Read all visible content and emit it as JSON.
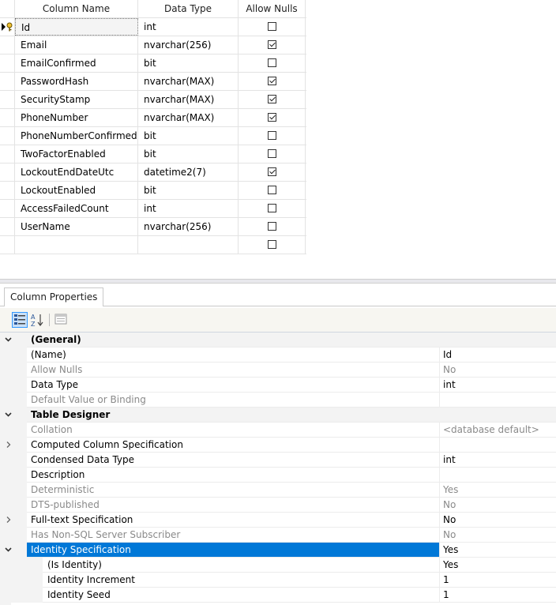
{
  "grid": {
    "headers": {
      "name": "Column Name",
      "type": "Data Type",
      "nulls": "Allow Nulls"
    },
    "rows": [
      {
        "name": "Id",
        "type": "int",
        "allow_nulls": false,
        "primary_key": true
      },
      {
        "name": "Email",
        "type": "nvarchar(256)",
        "allow_nulls": true
      },
      {
        "name": "EmailConfirmed",
        "type": "bit",
        "allow_nulls": false
      },
      {
        "name": "PasswordHash",
        "type": "nvarchar(MAX)",
        "allow_nulls": true
      },
      {
        "name": "SecurityStamp",
        "type": "nvarchar(MAX)",
        "allow_nulls": true
      },
      {
        "name": "PhoneNumber",
        "type": "nvarchar(MAX)",
        "allow_nulls": true
      },
      {
        "name": "PhoneNumberConfirmed",
        "type": "bit",
        "allow_nulls": false
      },
      {
        "name": "TwoFactorEnabled",
        "type": "bit",
        "allow_nulls": false
      },
      {
        "name": "LockoutEndDateUtc",
        "type": "datetime2(7)",
        "allow_nulls": true
      },
      {
        "name": "LockoutEnabled",
        "type": "bit",
        "allow_nulls": false
      },
      {
        "name": "AccessFailedCount",
        "type": "int",
        "allow_nulls": false
      },
      {
        "name": "UserName",
        "type": "nvarchar(256)",
        "allow_nulls": false
      },
      {
        "name": "",
        "type": "",
        "allow_nulls": false
      }
    ]
  },
  "properties": {
    "tab_label": "Column Properties",
    "rows": [
      {
        "label": "(General)",
        "value": "",
        "kind": "category",
        "expander": "collapse"
      },
      {
        "label": "(Name)",
        "value": "Id",
        "kind": "normal"
      },
      {
        "label": "Allow Nulls",
        "value": "No",
        "kind": "dim"
      },
      {
        "label": "Data Type",
        "value": "int",
        "kind": "normal"
      },
      {
        "label": "Default Value or Binding",
        "value": "",
        "kind": "dim"
      },
      {
        "label": "Table Designer",
        "value": "",
        "kind": "category",
        "expander": "collapse"
      },
      {
        "label": "Collation",
        "value": "<database default>",
        "kind": "dim"
      },
      {
        "label": "Computed Column Specification",
        "value": "",
        "kind": "normal",
        "expander": "expand"
      },
      {
        "label": "Condensed Data Type",
        "value": "int",
        "kind": "normal"
      },
      {
        "label": "Description",
        "value": "",
        "kind": "normal"
      },
      {
        "label": "Deterministic",
        "value": "Yes",
        "kind": "dim"
      },
      {
        "label": "DTS-published",
        "value": "No",
        "kind": "dim"
      },
      {
        "label": "Full-text Specification",
        "value": "No",
        "kind": "normal",
        "expander": "expand"
      },
      {
        "label": "Has Non-SQL Server Subscriber",
        "value": "No",
        "kind": "dim"
      },
      {
        "label": "Identity Specification",
        "value": "Yes",
        "kind": "selected",
        "expander": "collapse"
      },
      {
        "label": "(Is Identity)",
        "value": "Yes",
        "kind": "child"
      },
      {
        "label": "Identity Increment",
        "value": "1",
        "kind": "child"
      },
      {
        "label": "Identity Seed",
        "value": "1",
        "kind": "child"
      }
    ]
  },
  "icons": {
    "row_indicator": "current-row-key-icon",
    "toolbar": [
      "categorized-icon",
      "alphabetical-icon",
      "property-pages-icon"
    ]
  },
  "colors": {
    "selection": "#0078d7",
    "dim_text": "#8a8a8a"
  }
}
